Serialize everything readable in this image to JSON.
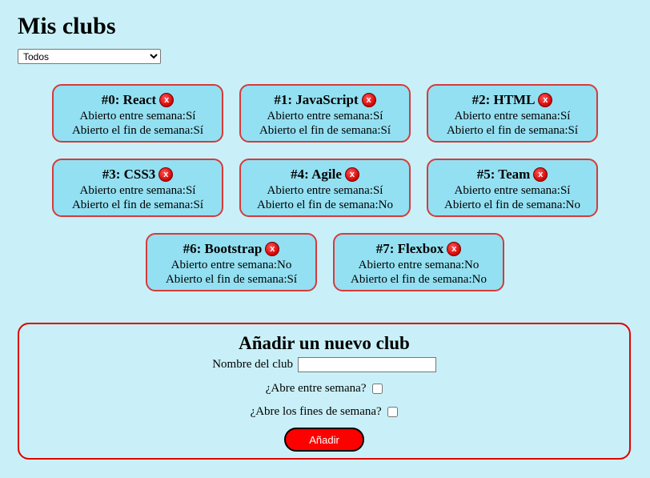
{
  "page": {
    "title": "Mis clubs"
  },
  "filter": {
    "selected": "Todos"
  },
  "clubs": [
    {
      "heading": "#0: React",
      "weekday": "Abierto entre semana:Sí",
      "weekend": "Abierto el fin de semana:Sí"
    },
    {
      "heading": "#1: JavaScript",
      "weekday": "Abierto entre semana:Sí",
      "weekend": "Abierto el fin de semana:Sí"
    },
    {
      "heading": "#2: HTML",
      "weekday": "Abierto entre semana:Sí",
      "weekend": "Abierto el fin de semana:Sí"
    },
    {
      "heading": "#3: CSS3",
      "weekday": "Abierto entre semana:Sí",
      "weekend": "Abierto el fin de semana:Sí"
    },
    {
      "heading": "#4: Agile",
      "weekday": "Abierto entre semana:Sí",
      "weekend": "Abierto el fin de semana:No"
    },
    {
      "heading": "#5: Team",
      "weekday": "Abierto entre semana:Sí",
      "weekend": "Abierto el fin de semana:No"
    },
    {
      "heading": "#6: Bootstrap",
      "weekday": "Abierto entre semana:No",
      "weekend": "Abierto el fin de semana:Sí"
    },
    {
      "heading": "#7: Flexbox",
      "weekday": "Abierto entre semana:No",
      "weekend": "Abierto el fin de semana:No"
    }
  ],
  "delete_label": "x",
  "form": {
    "title": "Añadir un nuevo club",
    "name_label": "Nombre del club",
    "name_value": "",
    "weekday_label": "¿Abre entre semana?",
    "weekend_label": "¿Abre los fines de semana?",
    "submit_label": "Añadir"
  },
  "colors": {
    "background": "#c9f0f8",
    "card_fill": "#93e0f2",
    "card_border": "#d63a3a",
    "accent": "#ff0000"
  }
}
